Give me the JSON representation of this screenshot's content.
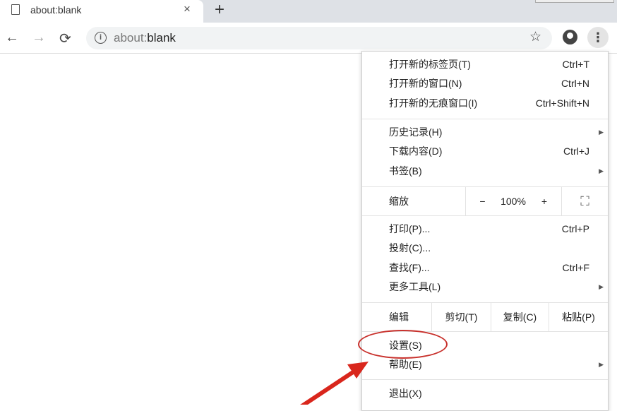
{
  "tab": {
    "title": "about:blank",
    "close": "×",
    "new_tab": "+"
  },
  "toolbar": {
    "back": "←",
    "forward": "→",
    "reload": "⟳",
    "info": "i",
    "url_prefix": "about:",
    "url_rest": "blank",
    "star": "☆",
    "more": "⋮"
  },
  "menu": {
    "items": [
      {
        "label": "打开新的标签页(T)",
        "shortcut": "Ctrl+T"
      },
      {
        "label": "打开新的窗口(N)",
        "shortcut": "Ctrl+N"
      },
      {
        "label": "打开新的无痕窗口(I)",
        "shortcut": "Ctrl+Shift+N"
      },
      {
        "label": "历史记录(H)"
      },
      {
        "label": "下载内容(D)",
        "shortcut": "Ctrl+J"
      },
      {
        "label": "书签(B)"
      },
      {
        "label": "打印(P)...",
        "shortcut": "Ctrl+P"
      },
      {
        "label": "投射(C)..."
      },
      {
        "label": "查找(F)...",
        "shortcut": "Ctrl+F"
      },
      {
        "label": "更多工具(L)"
      },
      {
        "label": "设置(S)"
      },
      {
        "label": "帮助(E)"
      },
      {
        "label": "退出(X)"
      }
    ],
    "zoom": {
      "label": "缩放",
      "minus": "−",
      "value": "100%",
      "plus": "+",
      "fullscreen": "⛶"
    },
    "edit": {
      "label": "编辑",
      "cut": "剪切(T)",
      "copy": "复制(C)",
      "paste": "粘贴(P)"
    },
    "submenu_arrow": "▶"
  },
  "annotation": {
    "color": "#c8312c"
  }
}
